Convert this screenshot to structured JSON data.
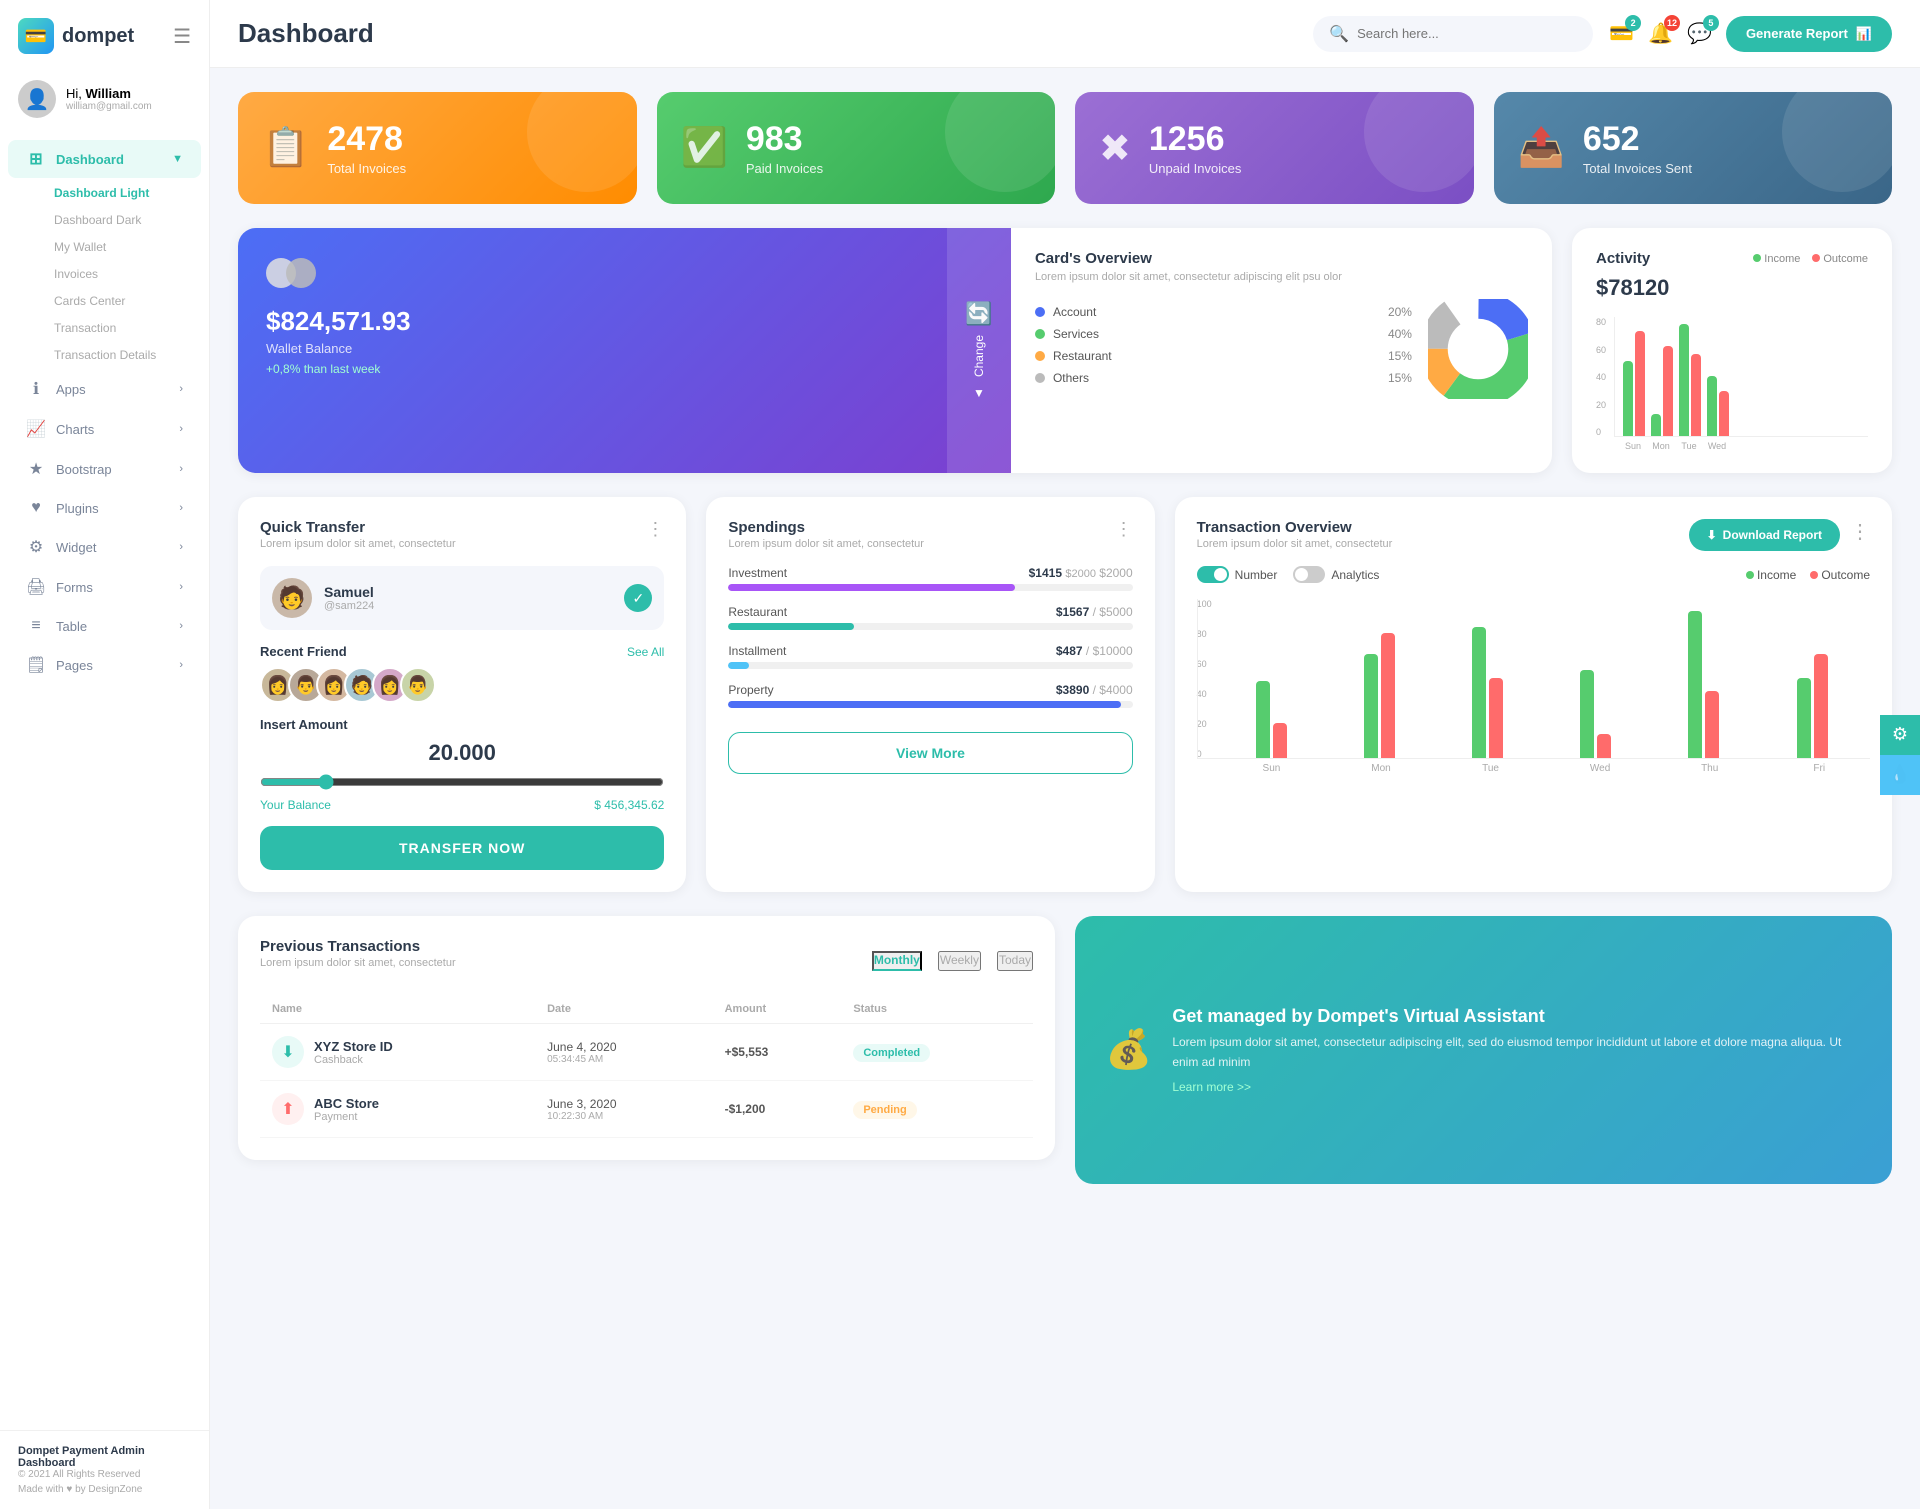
{
  "app": {
    "logo_text": "dompet",
    "title": "Dashboard"
  },
  "header": {
    "search_placeholder": "Search here...",
    "generate_btn": "Generate Report",
    "badge_wallet": "2",
    "badge_notif": "12",
    "badge_msg": "5"
  },
  "sidebar": {
    "user_hi": "Hi,",
    "user_name": "William",
    "user_email": "william@gmail.com",
    "menu": [
      {
        "label": "Dashboard",
        "icon": "⊞",
        "active": true,
        "has_arrow": true
      },
      {
        "label": "Apps",
        "icon": "ℹ",
        "active": false,
        "has_arrow": true
      },
      {
        "label": "Charts",
        "icon": "📈",
        "active": false,
        "has_arrow": true
      },
      {
        "label": "Bootstrap",
        "icon": "★",
        "active": false,
        "has_arrow": true
      },
      {
        "label": "Plugins",
        "icon": "♥",
        "active": false,
        "has_arrow": true
      },
      {
        "label": "Widget",
        "icon": "⚙",
        "active": false,
        "has_arrow": true
      },
      {
        "label": "Forms",
        "icon": "🖨",
        "active": false,
        "has_arrow": true
      },
      {
        "label": "Table",
        "icon": "≡",
        "active": false,
        "has_arrow": true
      },
      {
        "label": "Pages",
        "icon": "🗒",
        "active": false,
        "has_arrow": true
      }
    ],
    "sub_items": [
      {
        "label": "Dashboard Light",
        "active": true
      },
      {
        "label": "Dashboard Dark",
        "active": false
      },
      {
        "label": "My Wallet",
        "active": false
      },
      {
        "label": "Invoices",
        "active": false
      },
      {
        "label": "Cards Center",
        "active": false
      },
      {
        "label": "Transaction",
        "active": false
      },
      {
        "label": "Transaction Details",
        "active": false
      }
    ],
    "footer_title": "Dompet Payment Admin Dashboard",
    "footer_copy": "© 2021 All Rights Reserved",
    "footer_made": "Made with ♥ by DesignZone"
  },
  "stats": [
    {
      "num": "2478",
      "label": "Total Invoices",
      "icon": "📋",
      "color": "orange"
    },
    {
      "num": "983",
      "label": "Paid Invoices",
      "icon": "✅",
      "color": "green"
    },
    {
      "num": "1256",
      "label": "Unpaid Invoices",
      "icon": "✖",
      "color": "purple"
    },
    {
      "num": "652",
      "label": "Total Invoices Sent",
      "icon": "📊",
      "color": "blue-gray"
    }
  ],
  "wallet": {
    "amount": "$824,571.93",
    "label": "Wallet Balance",
    "change": "+0,8% than last week",
    "change_btn": "Change"
  },
  "cards_overview": {
    "title": "Card's Overview",
    "subtitle": "Lorem ipsum dolor sit amet, consectetur adipiscing elit psu olor",
    "legend": [
      {
        "label": "Account",
        "pct": "20%",
        "color": "#4c6ef5"
      },
      {
        "label": "Services",
        "pct": "40%",
        "color": "#56cc6e"
      },
      {
        "label": "Restaurant",
        "pct": "15%",
        "color": "#ffaa44"
      },
      {
        "label": "Others",
        "pct": "15%",
        "color": "#bbb"
      }
    ]
  },
  "activity": {
    "title": "Activity",
    "amount": "$78120",
    "income_label": "Income",
    "outcome_label": "Outcome",
    "bars": [
      {
        "day": "Sun",
        "income": 50,
        "outcome": 70
      },
      {
        "day": "Mon",
        "income": 15,
        "outcome": 60
      },
      {
        "day": "Tue",
        "income": 75,
        "outcome": 55
      },
      {
        "day": "Wed",
        "income": 40,
        "outcome": 30
      }
    ]
  },
  "quick_transfer": {
    "title": "Quick Transfer",
    "subtitle": "Lorem ipsum dolor sit amet, consectetur",
    "user_name": "Samuel",
    "user_handle": "@sam224",
    "recent_label": "Recent Friend",
    "see_all": "See All",
    "insert_label": "Insert Amount",
    "amount": "20.000",
    "balance_label": "Your Balance",
    "balance_value": "$ 456,345.62",
    "transfer_btn": "TRANSFER NOW",
    "friends": [
      "👩",
      "👨",
      "👩",
      "🧑",
      "👩",
      "👨"
    ]
  },
  "spendings": {
    "title": "Spendings",
    "subtitle": "Lorem ipsum dolor sit amet, consectetur",
    "items": [
      {
        "label": "Investment",
        "amount": "$1415",
        "max": "$2000",
        "pct": 71,
        "color": "#a855f7"
      },
      {
        "label": "Restaurant",
        "amount": "$1567",
        "max": "$5000",
        "pct": 31,
        "color": "#2dbdaa"
      },
      {
        "label": "Installment",
        "amount": "$487",
        "max": "$10000",
        "pct": 5,
        "color": "#4fc3f7"
      },
      {
        "label": "Property",
        "amount": "$3890",
        "max": "$4000",
        "pct": 97,
        "color": "#4c6ef5"
      }
    ],
    "view_more": "View More"
  },
  "transaction_overview": {
    "title": "Transaction Overview",
    "subtitle": "Lorem ipsum dolor sit amet, consectetur",
    "download_btn": "Download Report",
    "toggle1_label": "Number",
    "toggle2_label": "Analytics",
    "income_label": "Income",
    "outcome_label": "Outcome",
    "bars": [
      {
        "day": "Sun",
        "income": 48,
        "outcome": 22
      },
      {
        "day": "Mon",
        "income": 65,
        "outcome": 78
      },
      {
        "day": "Tue",
        "income": 82,
        "outcome": 50
      },
      {
        "day": "Wed",
        "income": 55,
        "outcome": 15
      },
      {
        "day": "Thu",
        "income": 92,
        "outcome": 42
      },
      {
        "day": "Fri",
        "income": 50,
        "outcome": 65
      }
    ]
  },
  "prev_transactions": {
    "title": "Previous Transactions",
    "subtitle": "Lorem ipsum dolor sit amet, consectetur",
    "tabs": [
      "Monthly",
      "Weekly",
      "Today"
    ],
    "active_tab": "Monthly",
    "rows": [
      {
        "icon": "⬇",
        "icon_type": "green",
        "name": "XYZ Store ID",
        "type": "Cashback",
        "date": "June 4, 2020",
        "time": "05:34:45 AM",
        "amount": "+$5,553",
        "amount_type": "pos",
        "status": "Completed"
      }
    ]
  },
  "va_banner": {
    "title": "Get managed by Dompet's Virtual Assistant",
    "desc": "Lorem ipsum dolor sit amet, consectetur adipiscing elit, sed do eiusmod tempor incididunt ut labore et dolore magna aliqua. Ut enim ad minim",
    "link": "Learn more >>"
  },
  "side_btns": {
    "gear": "⚙",
    "water": "💧"
  }
}
